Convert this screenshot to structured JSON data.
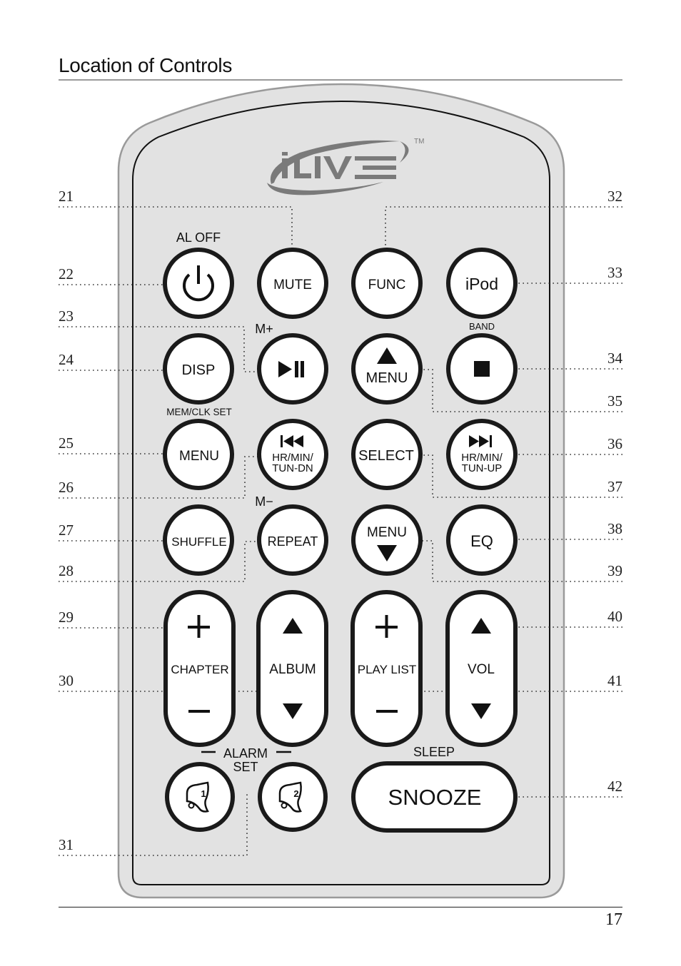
{
  "page": {
    "title": "Location of Controls",
    "page_number": "17"
  },
  "remote": {
    "brand": "iLIVE",
    "trademark": "TM",
    "captions": {
      "al_off": "AL OFF",
      "m_plus": "M+",
      "band": "BAND",
      "mem_clk_set": "MEM/CLK SET",
      "m_minus": "M−",
      "alarm": "ALARM",
      "set": "SET",
      "sleep": "SLEEP"
    },
    "buttons": {
      "power": {
        "icon": "power-icon"
      },
      "mute": {
        "label": "MUTE"
      },
      "func": {
        "label": "FUNC"
      },
      "ipod": {
        "label": "iPod"
      },
      "disp": {
        "label": "DISP"
      },
      "play_pause": {
        "icon": "play-pause-icon"
      },
      "menu_up": {
        "label": "MENU",
        "icon": "triangle-up-icon"
      },
      "stop": {
        "icon": "stop-icon"
      },
      "menu": {
        "label": "MENU"
      },
      "prev": {
        "icon": "skip-back-icon",
        "line1": "HR/MIN/",
        "line2": "TUN-DN"
      },
      "select": {
        "label": "SELECT"
      },
      "next": {
        "icon": "skip-forward-icon",
        "line1": "HR/MIN/",
        "line2": "TUN-UP"
      },
      "shuffle": {
        "label": "SHUFFLE"
      },
      "repeat": {
        "label": "REPEAT"
      },
      "menu_down": {
        "label": "MENU",
        "icon": "triangle-down-icon"
      },
      "eq": {
        "label": "EQ"
      },
      "chapter": {
        "label": "CHAPTER",
        "top": "+",
        "bottom": "−"
      },
      "album": {
        "label": "ALBUM",
        "top_icon": "triangle-up-icon",
        "bottom_icon": "triangle-down-icon"
      },
      "playlist": {
        "label": "PLAY LIST",
        "top": "+",
        "bottom": "−"
      },
      "vol": {
        "label": "VOL",
        "top_icon": "triangle-up-icon",
        "bottom_icon": "triangle-down-icon"
      },
      "alarm1": {
        "icon": "alarm-bell-icon",
        "number": "1"
      },
      "alarm2": {
        "icon": "alarm-bell-icon",
        "number": "2"
      },
      "snooze": {
        "label": "SNOOZE"
      }
    }
  },
  "callouts": {
    "left": [
      "21",
      "22",
      "23",
      "24",
      "25",
      "26",
      "27",
      "28",
      "29",
      "30",
      "31"
    ],
    "right": [
      "32",
      "33",
      "34",
      "35",
      "36",
      "37",
      "38",
      "39",
      "40",
      "41",
      "42"
    ]
  }
}
